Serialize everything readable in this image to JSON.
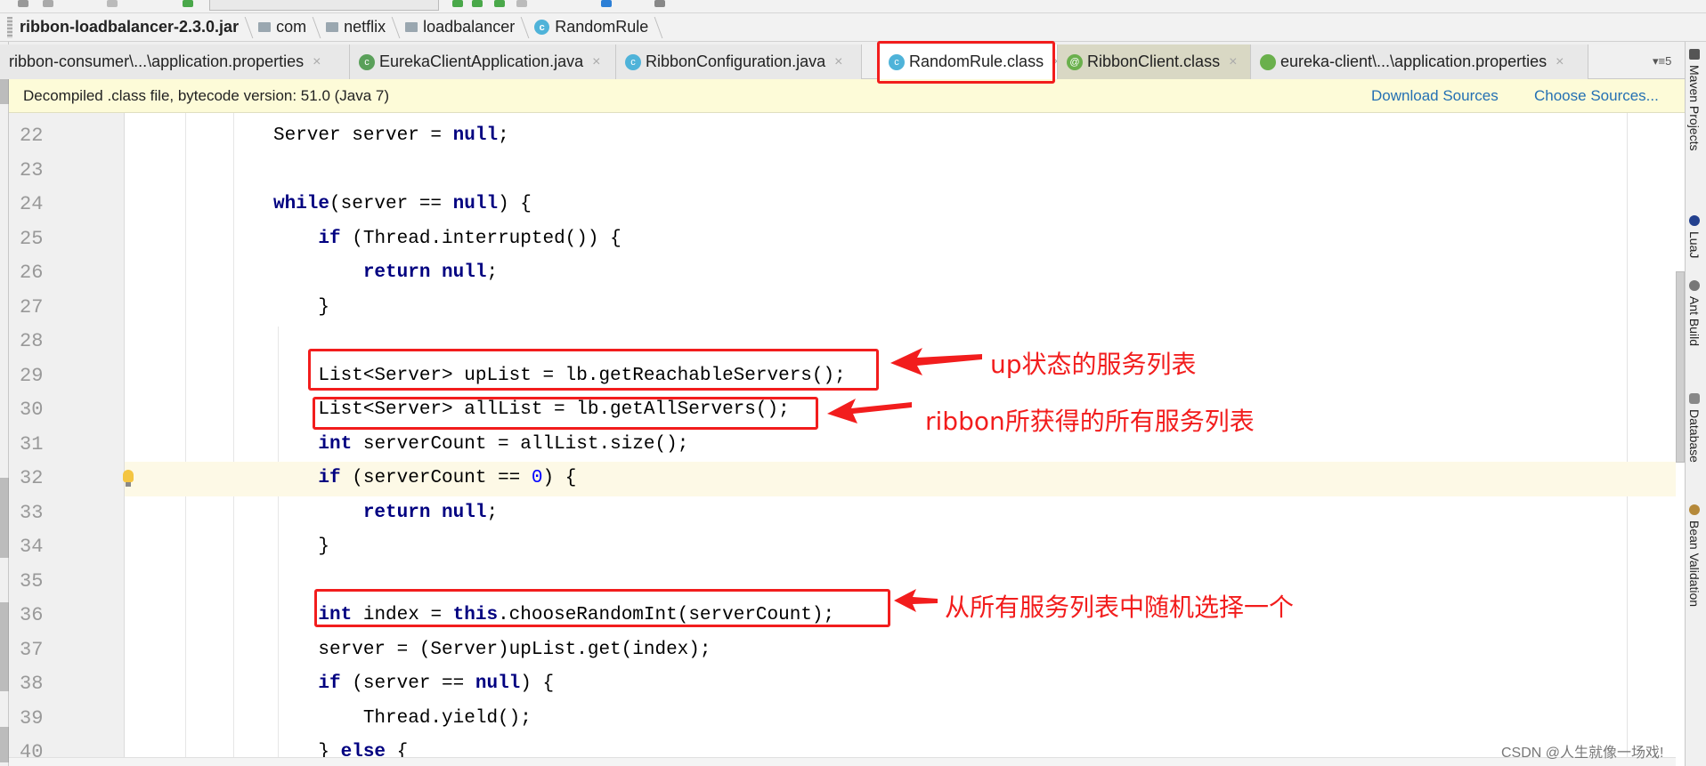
{
  "breadcrumb": {
    "items": [
      "ribbon-loadbalancer-2.3.0.jar",
      "com",
      "netflix",
      "loadbalancer",
      "RandomRule"
    ]
  },
  "tabs": [
    {
      "label": "ribbon-consumer\\...\\application.properties",
      "icon": "properties-leaf-icon",
      "active": false
    },
    {
      "label": "EurekaClientApplication.java",
      "icon": "spring-boot-class-icon",
      "active": false
    },
    {
      "label": "RibbonConfiguration.java",
      "icon": "class-icon",
      "active": false
    },
    {
      "label": "RandomRule.class",
      "icon": "class-icon",
      "active": true
    },
    {
      "label": "RibbonClient.class",
      "icon": "annotation-icon",
      "active": false
    },
    {
      "label": "eureka-client\\...\\application.properties",
      "icon": "properties-leaf-icon",
      "active": false
    }
  ],
  "tabs_overflow": "▾≡5",
  "banner": {
    "message": "Decompiled .class file, bytecode version: 51.0 (Java 7)",
    "download_sources": "Download Sources",
    "choose_sources": "Choose Sources..."
  },
  "code": {
    "highlighted_line": 32,
    "lines": [
      {
        "num": "22",
        "tokens": [
          [
            "Server server = ",
            ""
          ],
          [
            "null",
            "k"
          ],
          [
            ";",
            ""
          ]
        ]
      },
      {
        "num": "23",
        "tokens": []
      },
      {
        "num": "24",
        "tokens": [
          [
            "while",
            "k"
          ],
          [
            "(server == ",
            ""
          ],
          [
            "null",
            "k"
          ],
          [
            ") {",
            ""
          ]
        ]
      },
      {
        "num": "25",
        "tokens": [
          [
            "    ",
            ""
          ],
          [
            "if",
            "k"
          ],
          [
            " (Thread.interrupted()) {",
            ""
          ]
        ]
      },
      {
        "num": "26",
        "tokens": [
          [
            "        ",
            ""
          ],
          [
            "return null",
            "k"
          ],
          [
            ";",
            ""
          ]
        ]
      },
      {
        "num": "27",
        "tokens": [
          [
            "    }",
            ""
          ]
        ]
      },
      {
        "num": "28",
        "tokens": []
      },
      {
        "num": "29",
        "tokens": [
          [
            "    List<Server> upList = lb.getReachableServers();",
            ""
          ]
        ]
      },
      {
        "num": "30",
        "tokens": [
          [
            "    List<Server> allList = lb.getAllServers();",
            ""
          ]
        ]
      },
      {
        "num": "31",
        "tokens": [
          [
            "    ",
            ""
          ],
          [
            "int",
            "k"
          ],
          [
            " serverCount = allList.size();",
            ""
          ]
        ]
      },
      {
        "num": "32",
        "tokens": [
          [
            "    ",
            ""
          ],
          [
            "if",
            "k"
          ],
          [
            " (serverCount == ",
            ""
          ],
          [
            "0",
            "n"
          ],
          [
            ") {",
            ""
          ]
        ]
      },
      {
        "num": "33",
        "tokens": [
          [
            "        ",
            ""
          ],
          [
            "return null",
            "k"
          ],
          [
            ";",
            ""
          ]
        ]
      },
      {
        "num": "34",
        "tokens": [
          [
            "    }",
            ""
          ]
        ]
      },
      {
        "num": "35",
        "tokens": []
      },
      {
        "num": "36",
        "tokens": [
          [
            "    ",
            ""
          ],
          [
            "int",
            "k"
          ],
          [
            " index = ",
            ""
          ],
          [
            "this",
            "k"
          ],
          [
            ".chooseRandomInt(serverCount);",
            ""
          ]
        ]
      },
      {
        "num": "37",
        "tokens": [
          [
            "    server = (Server)upList.get(index);",
            ""
          ]
        ]
      },
      {
        "num": "38",
        "tokens": [
          [
            "    ",
            ""
          ],
          [
            "if",
            "k"
          ],
          [
            " (server == ",
            ""
          ],
          [
            "null",
            "k"
          ],
          [
            ") {",
            ""
          ]
        ]
      },
      {
        "num": "39",
        "tokens": [
          [
            "        Thread.yield();",
            ""
          ]
        ]
      },
      {
        "num": "40",
        "tokens": [
          [
            "    } ",
            ""
          ],
          [
            "else",
            "k"
          ],
          [
            " {",
            ""
          ]
        ]
      }
    ]
  },
  "annotations": {
    "up_list": "up状态的服务列表",
    "all_list": "ribbon所获得的所有服务列表",
    "random_choice": "从所有服务列表中随机选择一个",
    "color": "#f21d1d"
  },
  "right_sidebar": [
    "Maven Projects",
    "LuaJ",
    "Ant Build",
    "Database",
    "Bean Validation"
  ],
  "watermark": "CSDN @人生就像一场戏!"
}
